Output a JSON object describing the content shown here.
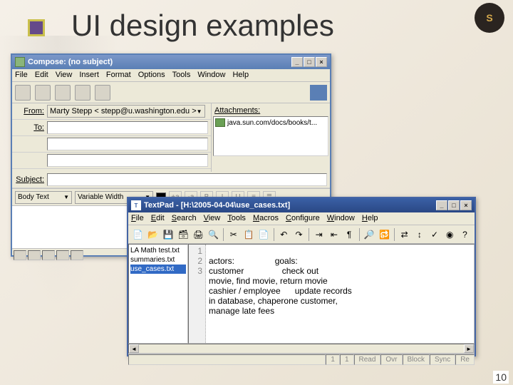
{
  "slide": {
    "title": "UI design examples",
    "page_number": "10",
    "logo_text": "S"
  },
  "compose": {
    "title": "Compose: (no subject)",
    "menus": [
      "File",
      "Edit",
      "View",
      "Insert",
      "Format",
      "Options",
      "Tools",
      "Window",
      "Help"
    ],
    "from_label": "From:",
    "from_value": "Marty Stepp < stepp@u.washington.edu >",
    "to_label": "To:",
    "to_value": "",
    "subject_label": "Subject:",
    "subject_value": "",
    "attach_label": "Attachments:",
    "attach_item": "java.sun.com/docs/books/t...",
    "body_text_label": "Body Text",
    "font_label": "Variable Width",
    "fmt_btns": [
      "+a",
      "-a",
      "B",
      "I",
      "U"
    ],
    "win_btns": {
      "min": "_",
      "max": "□",
      "close": "×"
    }
  },
  "textpad": {
    "title": "TextPad - [H:\\2005-04-04\\use_cases.txt]",
    "menus": [
      "File",
      "Edit",
      "Search",
      "View",
      "Tools",
      "Macros",
      "Configure",
      "Window",
      "Help"
    ],
    "sidebar_items": [
      "LA Math test.txt",
      "summaries.txt",
      "use_cases.txt"
    ],
    "gutter": [
      "1",
      "2",
      "",
      "3",
      "",
      ""
    ],
    "text_lines": [
      "actors:                 goals:",
      "customer                check out",
      "movie, find movie, return movie",
      "cashier / employee      update records",
      "in database, chaperone customer,",
      "manage late fees"
    ],
    "status": {
      "col": "1",
      "line": "1",
      "items": [
        "Read",
        "Ovr",
        "Block",
        "Sync",
        "Re"
      ]
    },
    "win_btns": {
      "min": "_",
      "max": "□",
      "close": "×"
    }
  }
}
